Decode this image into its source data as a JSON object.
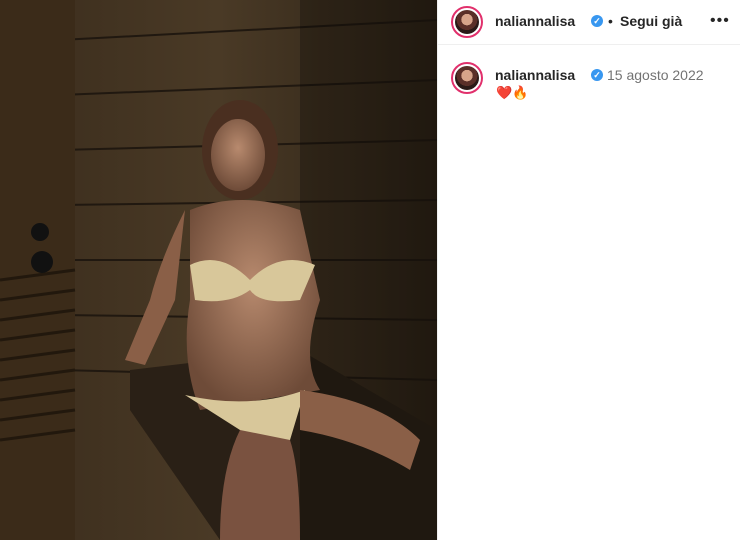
{
  "post": {
    "username": "naliannalisa",
    "separator": "•",
    "follow_label": "Segui già",
    "more_label": "•••",
    "verified_mark": "✓",
    "caption_username": "naliannalisa",
    "date": "15 agosto 2022",
    "caption_emojis": "❤️🔥"
  },
  "icons": {
    "verified": "verified-badge-icon",
    "more": "more-options-icon"
  },
  "colors": {
    "verified": "#3897f0",
    "story_ring": "#e1306c",
    "date_text": "#737373"
  }
}
